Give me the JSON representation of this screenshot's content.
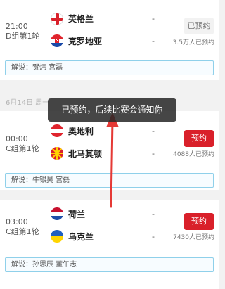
{
  "date_header": "6月14日 周一",
  "toast_text": "已预约，后续比赛会通知你",
  "matches": [
    {
      "time": "21:00",
      "group": "D组第1轮",
      "team_home": "英格兰",
      "team_away": "克罗地亚",
      "score_home": "-",
      "score_away": "-",
      "button": "已预约",
      "count": "3.5万人已预约",
      "commentary": "解说：贺炜 宫磊"
    },
    {
      "time": "00:00",
      "group": "C组第1轮",
      "team_home": "奥地利",
      "team_away": "北马其顿",
      "score_home": "-",
      "score_away": "-",
      "button": "预约",
      "count": "4088人已预约",
      "commentary": "解说：牛银昊 宫磊"
    },
    {
      "time": "03:00",
      "group": "C组第1轮",
      "team_home": "荷兰",
      "team_away": "乌克兰",
      "score_home": "-",
      "score_away": "-",
      "button": "预约",
      "count": "7430人已预约",
      "commentary": "解说：孙思辰 董午志"
    }
  ],
  "colors": {
    "accent_red": "#d9202a",
    "commentary_border": "#8fd0ea",
    "toast_bg": "#282828"
  },
  "icons": [
    "flag-england-icon",
    "flag-croatia-icon",
    "flag-austria-icon",
    "flag-north-macedonia-icon",
    "flag-netherlands-icon",
    "flag-ukraine-icon",
    "red-arrow-annotation"
  ]
}
